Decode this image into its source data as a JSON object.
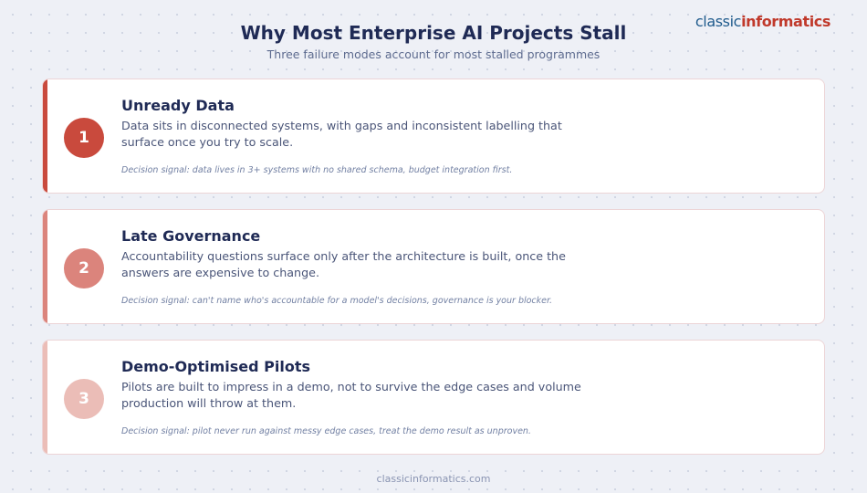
{
  "brand": {
    "logo_part1": "classic",
    "logo_part2": "informatics",
    "colors": {
      "part1": "#1e5a8c",
      "part2": "#c0392b"
    }
  },
  "header": {
    "title": "Why Most Enterprise AI Projects Stall",
    "subtitle": "Three failure modes account for most stalled programmes"
  },
  "cards": [
    {
      "number": "1",
      "heading": "Unready Data",
      "description": "Data sits in disconnected systems, with gaps and inconsistent labelling that surface once you try to scale.",
      "signal": "Decision signal: data lives in 3+ systems with no shared schema, budget integration first.",
      "color": "#c94a3d"
    },
    {
      "number": "2",
      "heading": "Late Governance",
      "description": "Accountability questions surface only after the architecture is built, once the answers are expensive to change.",
      "signal": "Decision signal: can't name who's accountable for a model's decisions, governance is your blocker.",
      "color": "#db847c"
    },
    {
      "number": "3",
      "heading": "Demo-Optimised Pilots",
      "description": "Pilots are built to impress in a demo, not to survive the edge cases and volume production will throw at them.",
      "signal": "Decision signal: pilot never run against messy edge cases, treat the demo result as unproven.",
      "color": "#ebbdb7"
    }
  ],
  "footer": {
    "url": "classicinformatics.com"
  }
}
